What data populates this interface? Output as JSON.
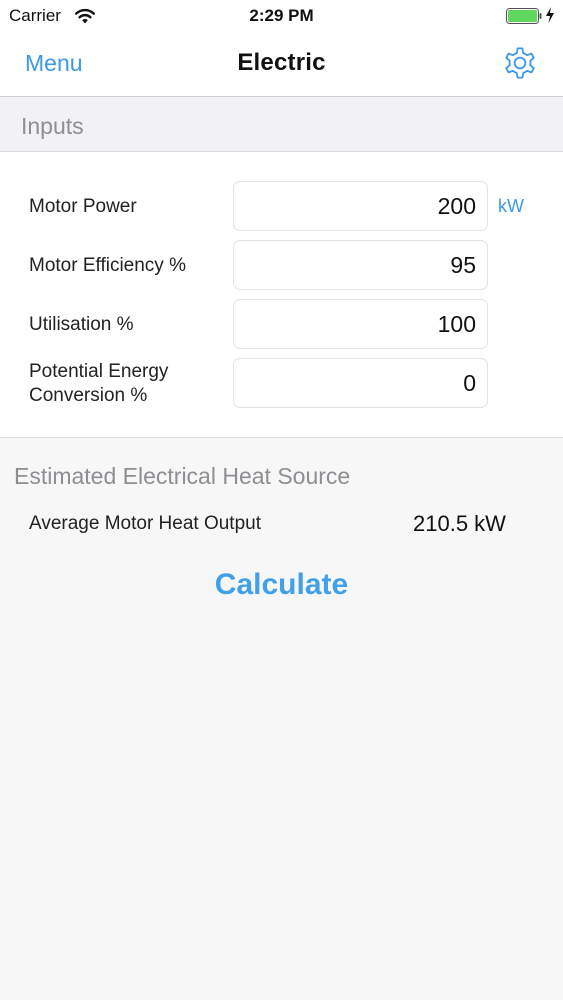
{
  "status_bar": {
    "carrier": "Carrier",
    "time": "2:29 PM",
    "wifi_icon": "wifi-icon",
    "battery_icon": "battery-charging-icon"
  },
  "navbar": {
    "menu_label": "Menu",
    "title": "Electric",
    "settings_icon": "gear-icon"
  },
  "inputs": {
    "header": "Inputs",
    "rows": [
      {
        "label": "Motor Power",
        "value": "200",
        "unit": "kW"
      },
      {
        "label": "Motor Efficiency %",
        "value": "95"
      },
      {
        "label": "Utilisation %",
        "value": "100"
      },
      {
        "label_line1": "Potential Energy",
        "label_line2": "Conversion %",
        "value": "0"
      }
    ]
  },
  "estimated": {
    "header": "Estimated Electrical Heat Source",
    "result_label": "Average Motor Heat Output",
    "result_value": "210.5 kW"
  },
  "actions": {
    "calculate_label": "Calculate"
  },
  "colors": {
    "accent": "#3d98e8",
    "battery": "#5ed85e"
  }
}
